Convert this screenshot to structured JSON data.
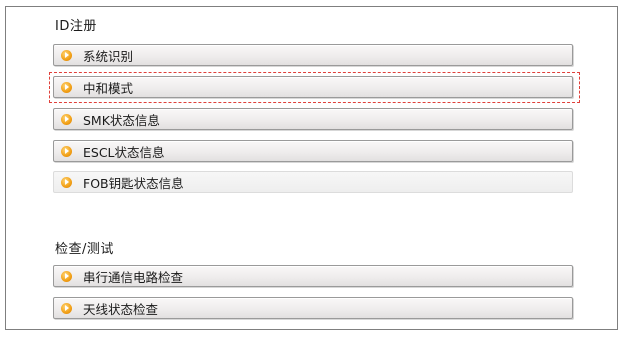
{
  "sections": [
    {
      "title": "ID注册",
      "items": [
        {
          "label": "系统识别"
        },
        {
          "label": "中和模式",
          "selected": true
        },
        {
          "label": "SMK状态信息"
        },
        {
          "label": "ESCL状态信息"
        },
        {
          "label": "FOB钥匙状态信息",
          "faded": true
        }
      ]
    },
    {
      "title": "检查/测试",
      "items": [
        {
          "label": "串行通信电路检查"
        },
        {
          "label": "天线状态检查"
        }
      ]
    }
  ],
  "colors": {
    "selection_outline": "#e0403a",
    "bullet": "#f3a31b",
    "frame_border": "#7f7f7f"
  },
  "icons": {
    "item_bullet": "orange-arrow-bullet-icon"
  }
}
